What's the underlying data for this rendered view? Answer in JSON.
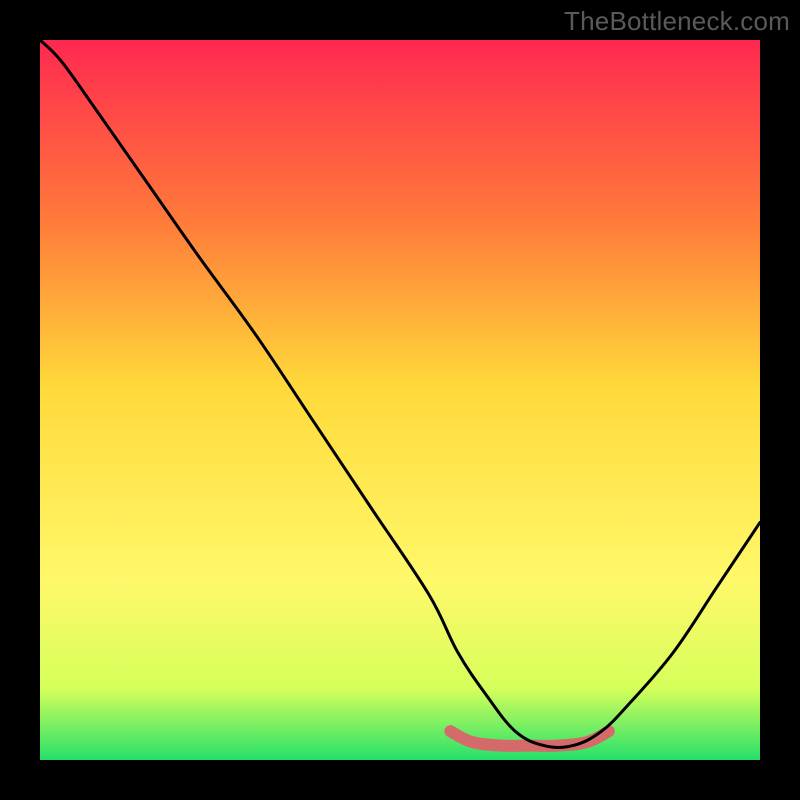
{
  "watermark": "TheBottleneck.com",
  "colors": {
    "frame_background": "#000000",
    "gradient_top": "#ff2850",
    "gradient_mid_upper": "#ff7a3a",
    "gradient_mid": "#ffd93a",
    "gradient_mid_lower": "#fff86a",
    "gradient_lower": "#d6ff5a",
    "gradient_bottom": "#25e06a",
    "curve": "#000000",
    "highlight": "#d46a6a"
  },
  "chart_data": {
    "type": "line",
    "title": "",
    "xlabel": "",
    "ylabel": "",
    "xlim": [
      0,
      100
    ],
    "ylim": [
      0,
      100
    ],
    "series": [
      {
        "name": "bottleneck-curve",
        "x": [
          0,
          3,
          8,
          15,
          22,
          30,
          38,
          46,
          54,
          58,
          62,
          66,
          70,
          74,
          78,
          82,
          88,
          94,
          100
        ],
        "values": [
          100,
          97,
          90,
          80,
          70,
          59,
          47,
          35,
          23,
          15,
          9,
          4,
          2,
          2,
          4,
          8,
          15,
          24,
          33
        ]
      },
      {
        "name": "optimal-range-highlight",
        "x": [
          57,
          60,
          64,
          68,
          72,
          76,
          79
        ],
        "values": [
          4,
          2.5,
          2,
          2,
          2,
          2.5,
          4
        ]
      }
    ],
    "annotations": []
  }
}
